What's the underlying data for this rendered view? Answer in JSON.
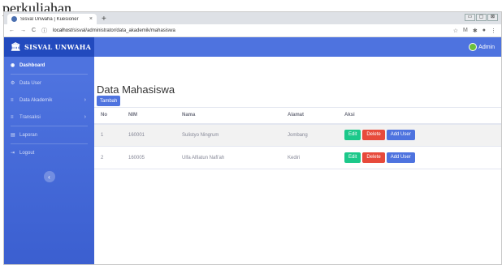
{
  "doc_snippet": "perkuliahan.",
  "browser": {
    "tab_title": "Sisval Unwaha | Kuesioner",
    "tab_close": "×",
    "new_tab": "+",
    "url_host": "localhost",
    "url_path": "/sisval/administrator/data_akademik/mahasiswa",
    "window_controls": [
      "▭",
      "▢",
      "⊠"
    ]
  },
  "topnav": {
    "brand_icon": "bank-icon",
    "brand": "SISVAL UNWAHA",
    "user": "Admin"
  },
  "sidebar": {
    "items": [
      {
        "icon": "dashboard-icon",
        "label": "Dashboard",
        "active": true,
        "has_chevron": false
      },
      {
        "icon": "user-icon",
        "label": "Data User",
        "active": false,
        "has_chevron": false
      },
      {
        "icon": "table-icon",
        "label": "Data Akademik",
        "active": false,
        "has_chevron": true
      },
      {
        "icon": "list-icon",
        "label": "Transaksi",
        "active": false,
        "has_chevron": true
      },
      {
        "icon": "report-icon",
        "label": "Laporan",
        "active": false,
        "has_chevron": false
      },
      {
        "icon": "logout-icon",
        "label": "Logout",
        "active": false,
        "has_chevron": false
      }
    ],
    "toggle_icon": "chevron-left-icon"
  },
  "main": {
    "title": "Data Mahasiswa",
    "add_button": "Tambah",
    "columns": [
      "No",
      "NIM",
      "Nama",
      "Alamat",
      "Aksi"
    ],
    "rows": [
      {
        "no": "1",
        "nim": "160001",
        "nama": "Sulistyo Ningrum",
        "alamat": "Jombang"
      },
      {
        "no": "2",
        "nim": "160005",
        "nama": "Ulfa Alfiatun Nafi'ah",
        "alamat": "Kediri"
      }
    ],
    "actions": {
      "edit": "Edit",
      "delete": "Delete",
      "add_user": "Add User"
    }
  },
  "colors": {
    "primary": "#4e73df",
    "sidebar_dark": "#224abe",
    "success": "#1cc88a",
    "danger": "#e74a3b"
  }
}
